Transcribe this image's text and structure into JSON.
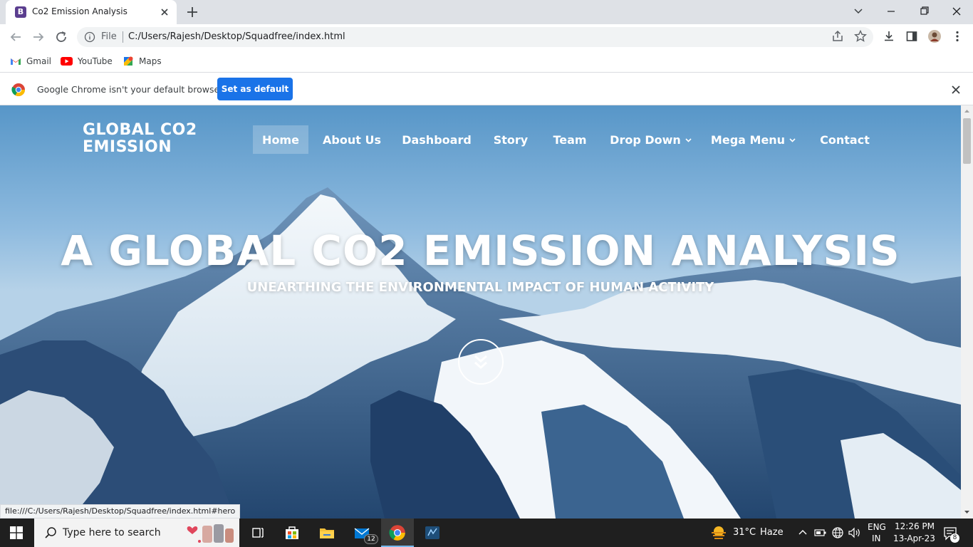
{
  "browser": {
    "tab_title": "Co2 Emission Analysis",
    "tab_favicon_letter": "B",
    "url_scheme_label": "File",
    "url": "C:/Users/Rajesh/Desktop/Squadfree/index.html",
    "bookmarks": [
      {
        "label": "Gmail",
        "icon": "gmail-icon"
      },
      {
        "label": "YouTube",
        "icon": "youtube-icon"
      },
      {
        "label": "Maps",
        "icon": "maps-icon"
      }
    ],
    "infobar": {
      "message": "Google Chrome isn't your default browser",
      "button_label": "Set as default"
    },
    "status_url": "file:///C:/Users/Rajesh/Desktop/Squadfree/index.html#hero"
  },
  "site": {
    "brand_line1": "GLOBAL CO2",
    "brand_line2": "EMISSION",
    "nav": [
      {
        "label": "Home",
        "active": true
      },
      {
        "label": "About Us"
      },
      {
        "label": "Dashboard"
      },
      {
        "label": "Story"
      },
      {
        "label": "Team"
      },
      {
        "label": "Drop Down",
        "dropdown": true
      },
      {
        "label": "Mega Menu",
        "dropdown": true
      },
      {
        "label": "Contact"
      }
    ],
    "hero_title": "A GLOBAL CO2 EMISSION ANALYSIS",
    "hero_subtitle": "UNEARTHING THE ENVIRONMENTAL IMPACT OF HUMAN ACTIVITY"
  },
  "taskbar": {
    "search_placeholder": "Type here to search",
    "mail_badge": "12",
    "weather_temp": "31°C",
    "weather_desc": "Haze",
    "lang_line1": "ENG",
    "lang_line2": "IN",
    "time": "12:26 PM",
    "date": "13-Apr-23",
    "notification_count": "8"
  },
  "colors": {
    "primary_button": "#1a73e8",
    "taskbar": "#1f1f1f",
    "favicon": "#5b3e8f"
  }
}
